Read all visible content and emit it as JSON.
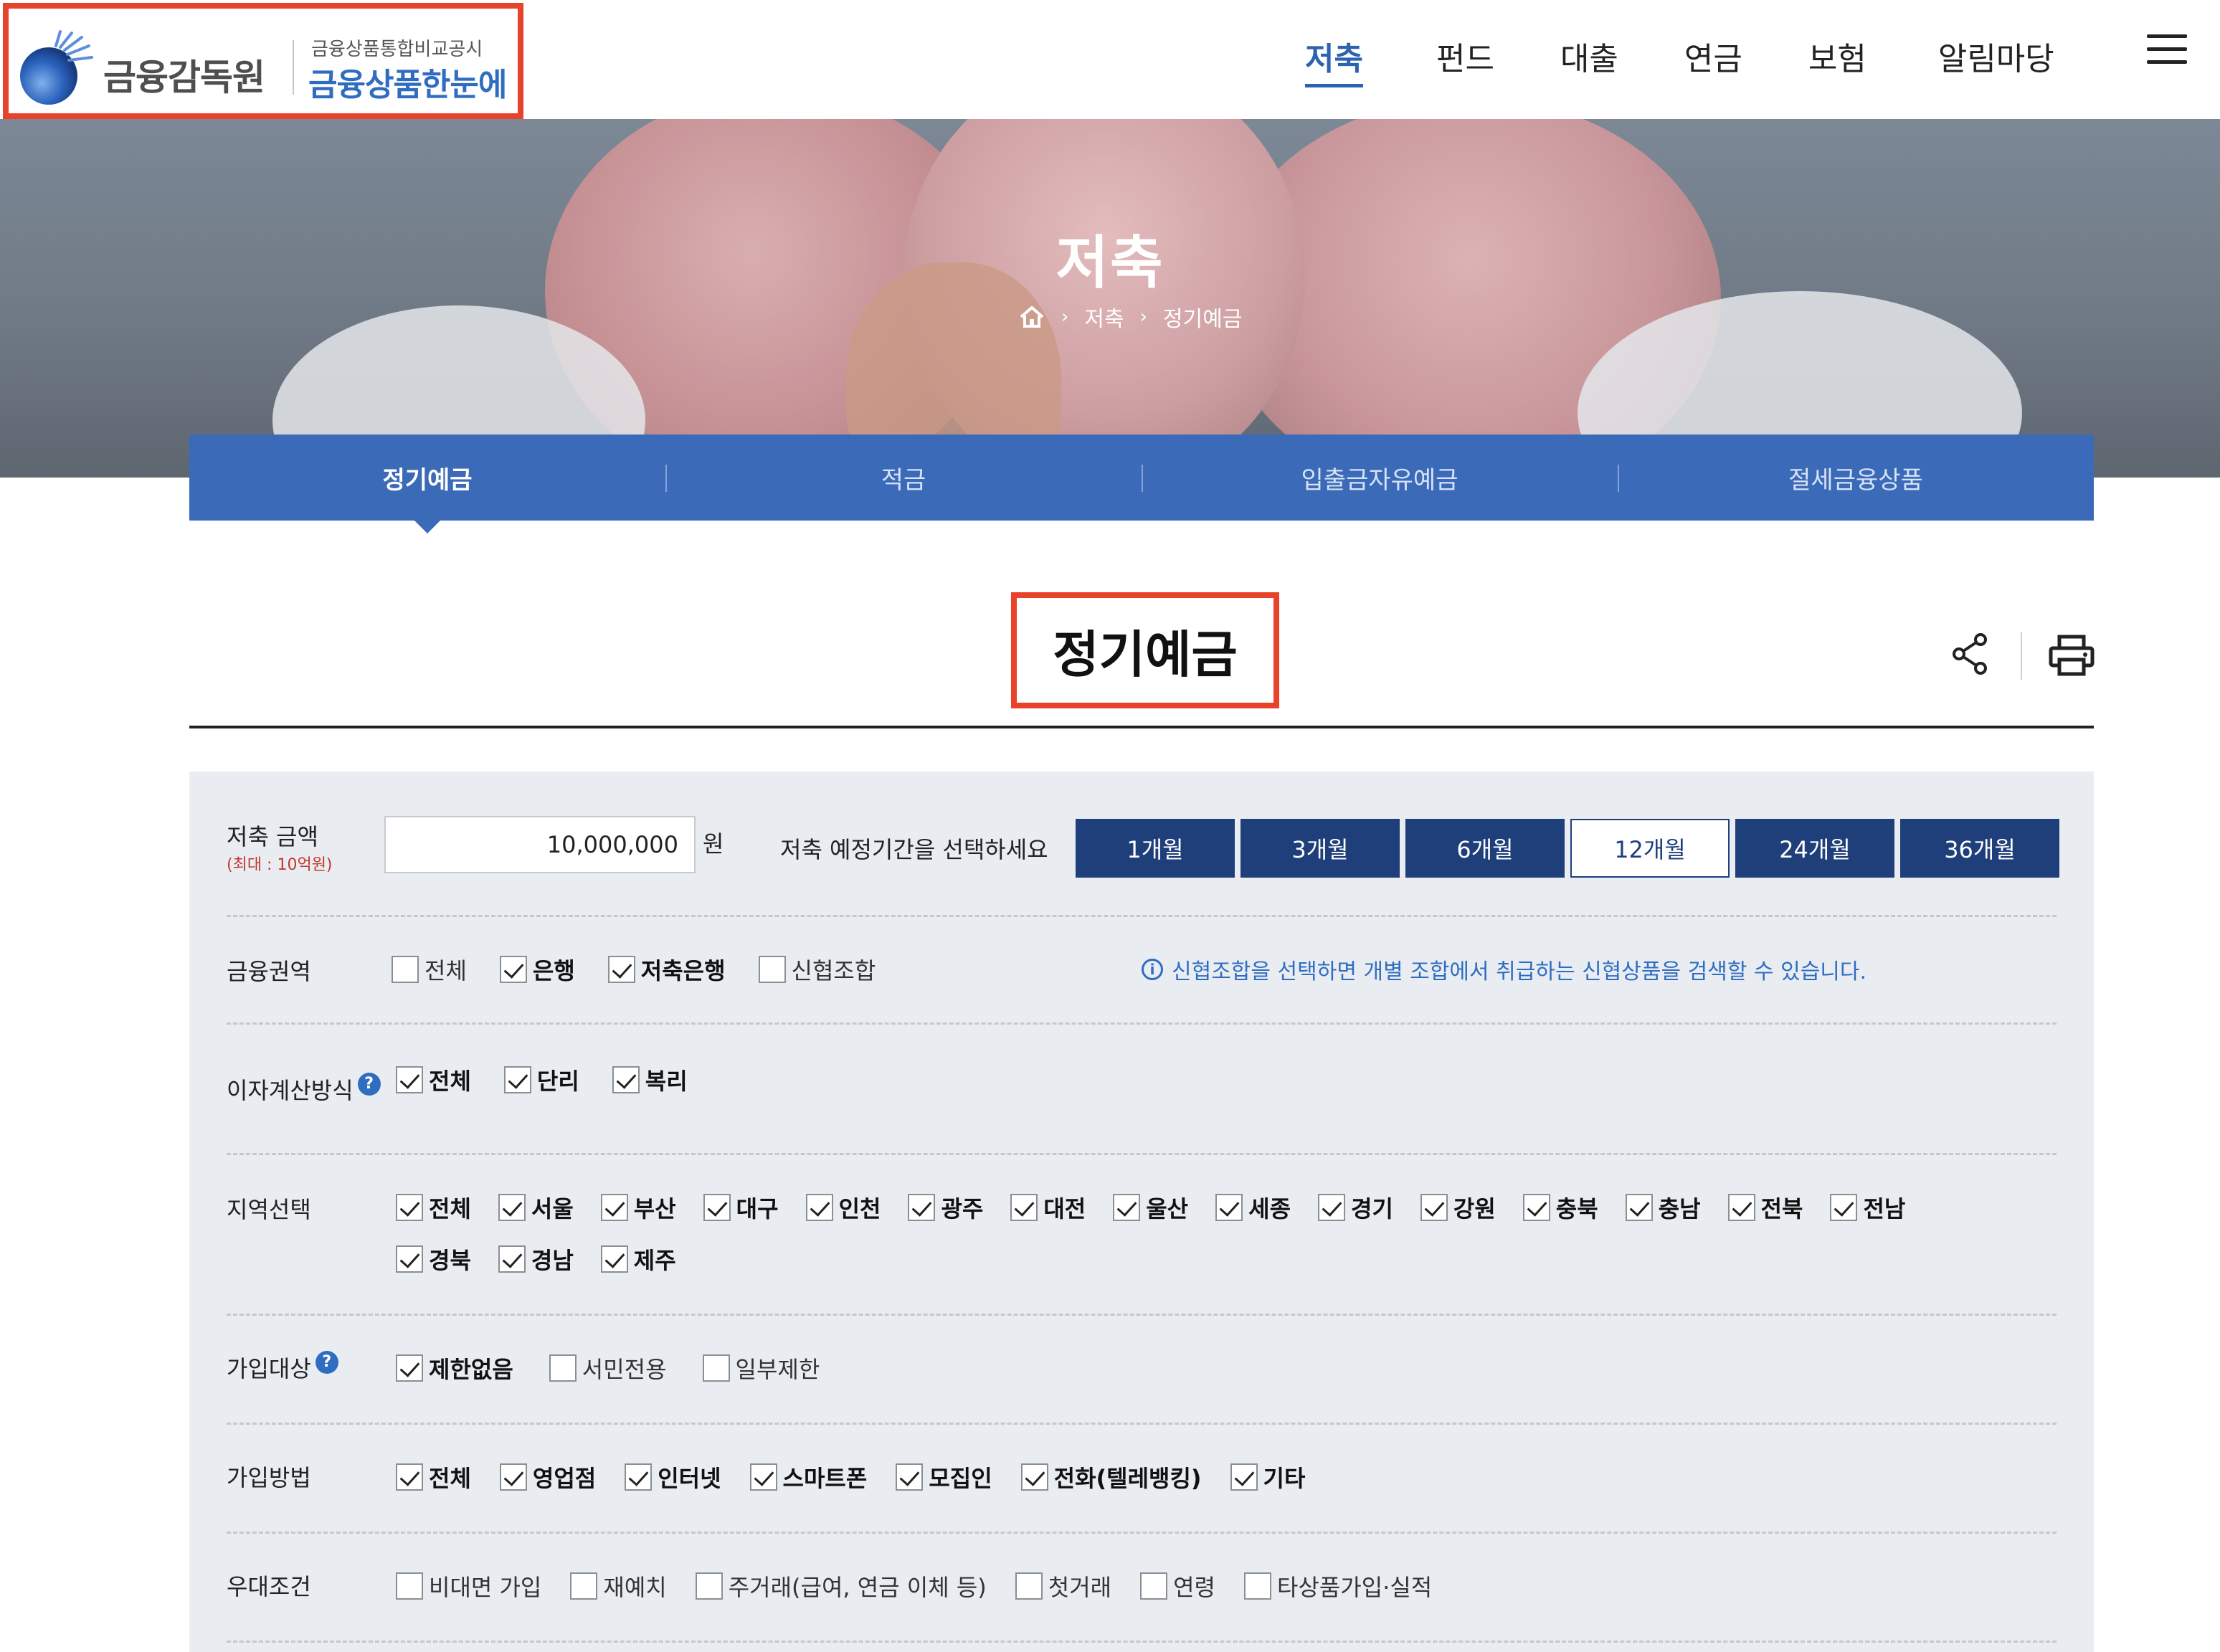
{
  "header": {
    "logo_name": "금융감독원",
    "logo_sub": "금융상품통합비교공시",
    "logo_service": "금융상품한눈에",
    "nav": [
      {
        "label": "저축",
        "active": true
      },
      {
        "label": "펀드",
        "active": false
      },
      {
        "label": "대출",
        "active": false
      },
      {
        "label": "연금",
        "active": false
      },
      {
        "label": "보험",
        "active": false
      },
      {
        "label": "알림마당",
        "active": false
      }
    ]
  },
  "hero": {
    "title": "저축",
    "breadcrumb": [
      "저축",
      "정기예금"
    ]
  },
  "tabs": [
    {
      "label": "정기예금",
      "active": true
    },
    {
      "label": "적금",
      "active": false
    },
    {
      "label": "입출금자유예금",
      "active": false
    },
    {
      "label": "절세금융상품",
      "active": false
    }
  ],
  "page": {
    "title": "정기예금"
  },
  "filters": {
    "amount": {
      "label": "저축 금액",
      "hint": "(최대 : 10억원)",
      "value": "10,000,000",
      "unit": "원"
    },
    "period": {
      "label": "저축 예정기간을 선택하세요",
      "options": [
        {
          "label": "1개월",
          "selected": false
        },
        {
          "label": "3개월",
          "selected": false
        },
        {
          "label": "6개월",
          "selected": false
        },
        {
          "label": "12개월",
          "selected": true
        },
        {
          "label": "24개월",
          "selected": false
        },
        {
          "label": "36개월",
          "selected": false
        }
      ]
    },
    "sector": {
      "label": "금융권역",
      "options": [
        {
          "label": "전체",
          "checked": false
        },
        {
          "label": "은행",
          "checked": true
        },
        {
          "label": "저축은행",
          "checked": true
        },
        {
          "label": "신협조합",
          "checked": false
        }
      ],
      "note": "신협조합을 선택하면 개별 조합에서 취급하는 신협상품을 검색할 수 있습니다."
    },
    "interest": {
      "label": "이자계산방식",
      "options": [
        {
          "label": "전체",
          "checked": true
        },
        {
          "label": "단리",
          "checked": true
        },
        {
          "label": "복리",
          "checked": true
        }
      ]
    },
    "region": {
      "label": "지역선택",
      "options": [
        {
          "label": "전체",
          "checked": true
        },
        {
          "label": "서울",
          "checked": true
        },
        {
          "label": "부산",
          "checked": true
        },
        {
          "label": "대구",
          "checked": true
        },
        {
          "label": "인천",
          "checked": true
        },
        {
          "label": "광주",
          "checked": true
        },
        {
          "label": "대전",
          "checked": true
        },
        {
          "label": "울산",
          "checked": true
        },
        {
          "label": "세종",
          "checked": true
        },
        {
          "label": "경기",
          "checked": true
        },
        {
          "label": "강원",
          "checked": true
        },
        {
          "label": "충북",
          "checked": true
        },
        {
          "label": "충남",
          "checked": true
        },
        {
          "label": "전북",
          "checked": true
        },
        {
          "label": "전남",
          "checked": true
        },
        {
          "label": "경북",
          "checked": true
        },
        {
          "label": "경남",
          "checked": true
        },
        {
          "label": "제주",
          "checked": true
        }
      ]
    },
    "target": {
      "label": "가입대상",
      "options": [
        {
          "label": "제한없음",
          "checked": true
        },
        {
          "label": "서민전용",
          "checked": false
        },
        {
          "label": "일부제한",
          "checked": false
        }
      ]
    },
    "method": {
      "label": "가입방법",
      "options": [
        {
          "label": "전체",
          "checked": true
        },
        {
          "label": "영업점",
          "checked": true
        },
        {
          "label": "인터넷",
          "checked": true
        },
        {
          "label": "스마트폰",
          "checked": true
        },
        {
          "label": "모집인",
          "checked": true
        },
        {
          "label": "전화(텔레뱅킹)",
          "checked": true
        },
        {
          "label": "기타",
          "checked": true
        }
      ]
    },
    "preferential": {
      "label": "우대조건",
      "options": [
        {
          "label": "비대면 가입",
          "checked": false
        },
        {
          "label": "재예치",
          "checked": false
        },
        {
          "label": "주거래(급여, 연금 이체 등)",
          "checked": false
        },
        {
          "label": "첫거래",
          "checked": false
        },
        {
          "label": "연령",
          "checked": false
        },
        {
          "label": "타상품가입·실적",
          "checked": false
        }
      ]
    }
  },
  "icons": {
    "help": "?",
    "info": "i"
  },
  "colors": {
    "accent": "#2d62b0",
    "tab_bar": "#3a6ab8",
    "period_button": "#1f3f7a",
    "highlight_border": "#e8432a",
    "panel_bg": "#e9edf2"
  }
}
